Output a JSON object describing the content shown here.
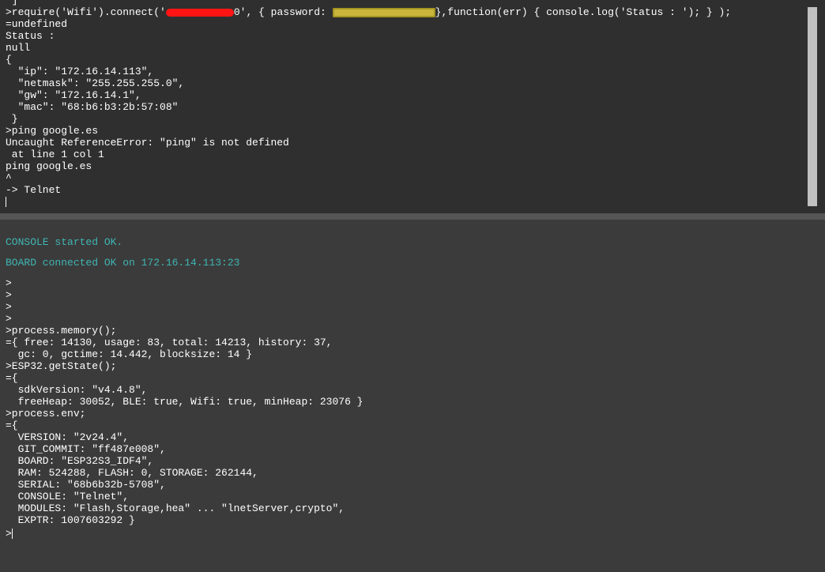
{
  "top_console": {
    "lines": [
      " ]",
      ">require('Wifi').connect('",
      "=undefined",
      "Status :",
      "null",
      "{",
      "  \"ip\": \"172.16.14.113\",",
      "  \"netmask\": \"255.255.255.0\",",
      "  \"gw\": \"172.16.14.1\",",
      "  \"mac\": \"68:b6:b3:2b:57:08\"",
      " }",
      ">ping google.es",
      "Uncaught ReferenceError: \"ping\" is not defined",
      " at line 1 col 1",
      "ping google.es",
      "^",
      "-> Telnet"
    ],
    "connect_line": {
      "prefix": ">require('Wifi').connect('",
      "redacted_ssid_tail": "0', { password: ",
      "suffix": "},function(err) { console.log('Status : '); } );"
    }
  },
  "bottom_console": {
    "status_messages": [
      "CONSOLE started OK.",
      "BOARD connected OK on 172.16.14.113:23"
    ],
    "lines": [
      ">",
      ">",
      ">",
      ">",
      ">process.memory();",
      "={ free: 14130, usage: 83, total: 14213, history: 37,",
      "  gc: 0, gctime: 14.442, blocksize: 14 }",
      ">ESP32.getState();",
      "={",
      "  sdkVersion: \"v4.4.8\",",
      "  freeHeap: 30052, BLE: true, Wifi: true, minHeap: 23076 }",
      ">process.env;",
      "={",
      "  VERSION: \"2v24.4\",",
      "  GIT_COMMIT: \"ff487e008\",",
      "  BOARD: \"ESP32S3_IDF4\",",
      "  RAM: 524288, FLASH: 0, STORAGE: 262144,",
      "  SERIAL: \"68b6b32b-5708\",",
      "  CONSOLE: \"Telnet\",",
      "  MODULES: \"Flash,Storage,hea\" ... \"lnetServer,crypto\",",
      "  EXPTR: 1007603292 }"
    ],
    "prompt": ">"
  },
  "colors": {
    "info_text": "#3fb6b3",
    "redaction_red": "#ff1414",
    "redaction_yellow": "#c8b53a"
  }
}
